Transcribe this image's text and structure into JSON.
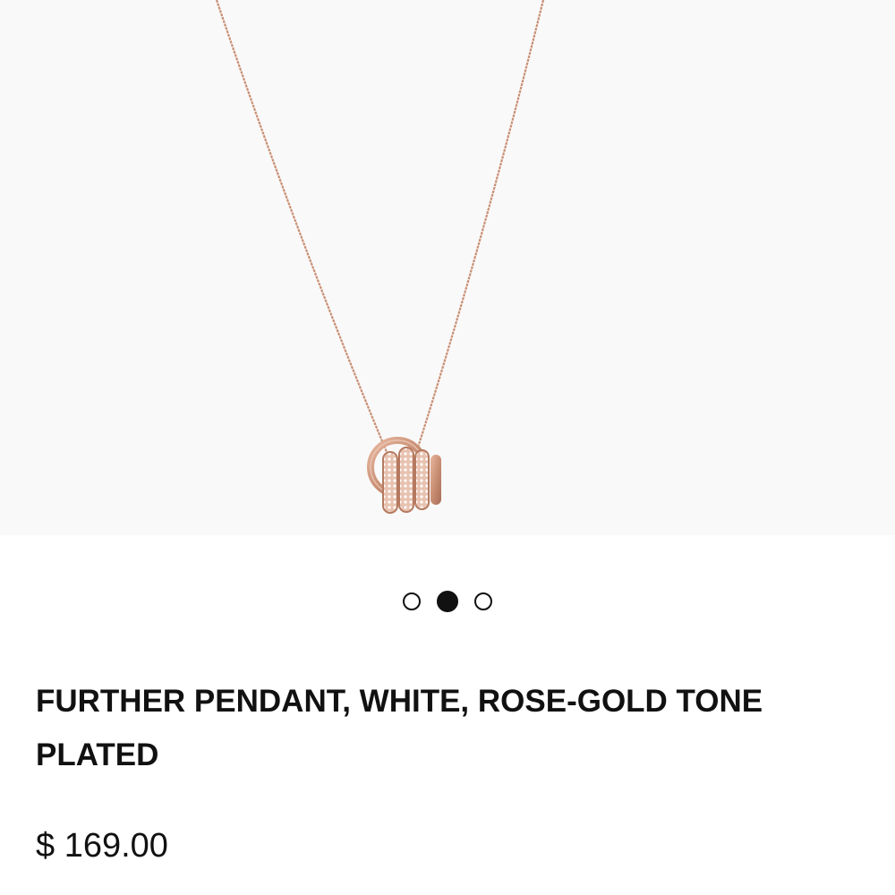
{
  "product": {
    "title": "FURTHER PENDANT, WHITE, ROSE-GOLD TONE PLATED",
    "price": "$ 169.00",
    "image_icon": "pendant-necklace-image"
  },
  "carousel": {
    "dot_count": 3,
    "active_index": 1
  },
  "colors": {
    "chain": "#c98f74",
    "text": "#111111",
    "image_background": "#f9f9f9"
  }
}
